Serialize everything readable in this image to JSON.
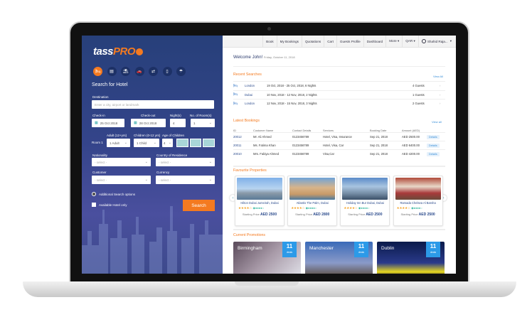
{
  "brand": {
    "logo": "tassPRO",
    "accent": "#f47a20",
    "navy": "#27407a"
  },
  "search": {
    "service_icons": [
      "hotel-icon",
      "apartment-icon",
      "holiday-icon",
      "car-icon",
      "transfer-icon",
      "visa-icon",
      "insurance-icon"
    ],
    "title": "Search for Hotel",
    "destination_label": "Destination",
    "destination_placeholder": "Enter a city, airport or landmark",
    "checkin_label": "Check-in",
    "checkin_value": "25 Oct 2018",
    "checkout_label": "Check-out",
    "checkout_value": "28 Oct 2018",
    "nights_label": "Night(s)",
    "nights_value": "4",
    "rooms_label": "No. of Room(s)",
    "rooms_value": "1",
    "adult_label": "Adult (12+yrs)",
    "children_label": "Children (0-12 yrs)",
    "age_label": "Age of Children",
    "room_label": "Room 1",
    "adult_value": "1 Adult",
    "child_value": "1 Child",
    "age_value": "4",
    "nationality_label": "Nationality",
    "residence_label": "Country of Residence",
    "customer_label": "Customer",
    "currency_label": "Currency",
    "select_placeholder": "- select -",
    "additional_options": "Additional Search options",
    "available_only": "Available Hotel only",
    "search_button": "Search"
  },
  "nav": {
    "items": [
      "Book",
      "My Bookings",
      "Quotations",
      "Cart",
      "Guests Profile",
      "Dashboard",
      "More ▾",
      "QAR ▾"
    ],
    "user": "Shahid Raja..."
  },
  "welcome": {
    "title": "Welcome John!",
    "date": "Friday, October 11, 2018"
  },
  "recent": {
    "title": "Recent Searches",
    "view_all": "View All",
    "rows": [
      {
        "city": "London",
        "dates": "19 Oct, 2018 - 25 Oct, 2018, 6 Nights",
        "guests": "4 Guests"
      },
      {
        "city": "Dubai",
        "dates": "10 Nov, 2018 - 12 Nov, 2018, 2 Nights",
        "guests": "1 Guests"
      },
      {
        "city": "London",
        "dates": "12 Nov, 2018 - 15 Nov, 2018, 3 Nights",
        "guests": "2 Guests"
      }
    ]
  },
  "bookings": {
    "title": "Latest Bookings",
    "view_all": "View all",
    "columns": [
      "ID",
      "Customer Name",
      "Contact Details",
      "Services",
      "Booking Date",
      "Amount (AED)"
    ],
    "details_label": "Details",
    "rows": [
      [
        "20012",
        "Mr. Ali Ahmed",
        "0123456789",
        "Hotel, Visa, Insurance",
        "Sep 21, 2018",
        "AED 2500.00"
      ],
      [
        "20011",
        "Ms. Fatima Khan",
        "0123456789",
        "Hotel, Visa, Car",
        "Sep 21, 2018",
        "AED 6400.00"
      ],
      [
        "20010",
        "Mrs. Fabiya Ahmed",
        "0123456789",
        "Visa,Car",
        "Sep 21, 2018",
        "AED 4200.00"
      ]
    ]
  },
  "favourites": {
    "title": "Favourite Properties",
    "price_label": "Starting Price",
    "items": [
      {
        "name": "Hilton Dubai Jumeirah, Dubai",
        "price": "AED 2500",
        "stars": 4
      },
      {
        "name": "Atlantis The Palm, Dubai",
        "price": "AED 2800",
        "stars": 4
      },
      {
        "name": "Holiday Inn Bur Dubai, Dubai",
        "price": "AED 2500",
        "stars": 4
      },
      {
        "name": "Ramada Chelsea Al Barsha",
        "price": "AED 2500",
        "stars": 4
      }
    ]
  },
  "promotions": {
    "title": "Current Promotions",
    "items": [
      {
        "city": "Birmingham",
        "count": "11",
        "unit": "deals"
      },
      {
        "city": "Manchester",
        "count": "11",
        "unit": "deals"
      },
      {
        "city": "Dublin",
        "count": "11",
        "unit": "deals"
      }
    ]
  }
}
